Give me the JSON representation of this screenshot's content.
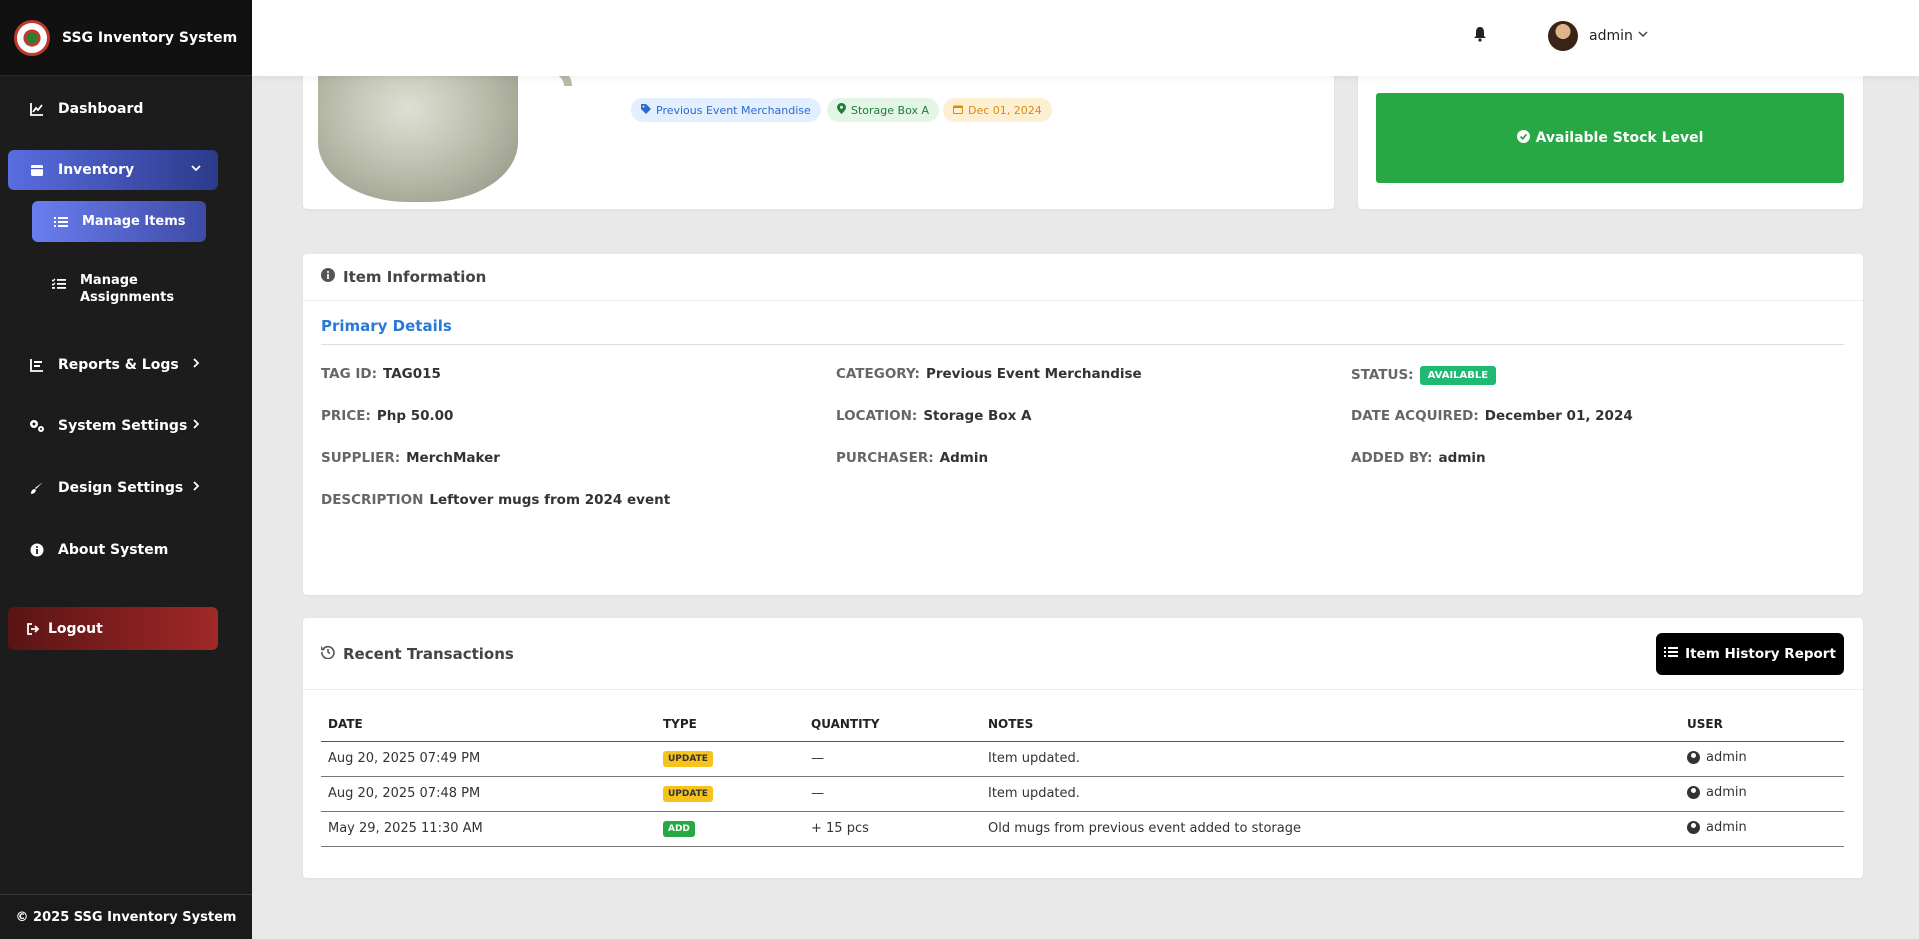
{
  "brand": {
    "title": "SSG Inventory System"
  },
  "sidebar": {
    "items": [
      {
        "label": "Dashboard",
        "icon": "chart-line-icon"
      },
      {
        "label": "Inventory",
        "icon": "box-icon"
      },
      {
        "label": "Manage Items",
        "icon": "list-icon"
      },
      {
        "label": "Manage Assignments",
        "icon": "tasks-icon"
      },
      {
        "label": "Reports & Logs",
        "icon": "chart-area-icon"
      },
      {
        "label": "System Settings",
        "icon": "gears-icon"
      },
      {
        "label": "Design Settings",
        "icon": "paint-brush-icon"
      },
      {
        "label": "About System",
        "icon": "info-icon"
      }
    ],
    "logout_label": "Logout",
    "footer": "© 2025 SSG Inventory System"
  },
  "topbar": {
    "user": "admin"
  },
  "item": {
    "tags": {
      "category": "Previous Event Merchandise",
      "location": "Storage Box A",
      "date": "Dec 01, 2024"
    },
    "stock_label": "Available Stock Level"
  },
  "info": {
    "header": "Item Information",
    "section_title": "Primary Details",
    "tag_id": {
      "label": "TAG ID:",
      "value": "TAG015"
    },
    "category": {
      "label": "CATEGORY:",
      "value": "Previous Event Merchandise"
    },
    "status": {
      "label": "STATUS:",
      "value": "AVAILABLE"
    },
    "price": {
      "label": "PRICE:",
      "value": "Php 50.00"
    },
    "location": {
      "label": "LOCATION:",
      "value": "Storage Box A"
    },
    "date_acquired": {
      "label": "DATE ACQUIRED:",
      "value": "December 01, 2024"
    },
    "supplier": {
      "label": "SUPPLIER:",
      "value": "MerchMaker"
    },
    "purchaser": {
      "label": "PURCHASER:",
      "value": "Admin"
    },
    "added_by": {
      "label": "ADDED BY:",
      "value": "admin"
    },
    "description": {
      "label": "DESCRIPTION",
      "value": "Leftover mugs from 2024 event"
    }
  },
  "transactions": {
    "header": "Recent Transactions",
    "report_button": "Item History Report",
    "columns": [
      "DATE",
      "TYPE",
      "QUANTITY",
      "NOTES",
      "USER"
    ],
    "rows": [
      {
        "date": "Aug 20, 2025 07:49 PM",
        "type": "UPDATE",
        "quantity": "—",
        "notes": "Item updated.",
        "user": "admin"
      },
      {
        "date": "Aug 20, 2025 07:48 PM",
        "type": "UPDATE",
        "quantity": "—",
        "notes": "Item updated.",
        "user": "admin"
      },
      {
        "date": "May 29, 2025 11:30 AM",
        "type": "ADD",
        "quantity": "+ 15 pcs",
        "notes": "Old mugs from previous event added to storage",
        "user": "admin"
      }
    ]
  },
  "colors": {
    "sidebar_bg": "#1c1c1c",
    "accent": "#5a6de0",
    "stock_green": "#28a745",
    "logout_red": "#a02828",
    "status_green": "#1fba72",
    "update_yellow": "#f6c21c",
    "link_blue": "#2a7ad5"
  }
}
